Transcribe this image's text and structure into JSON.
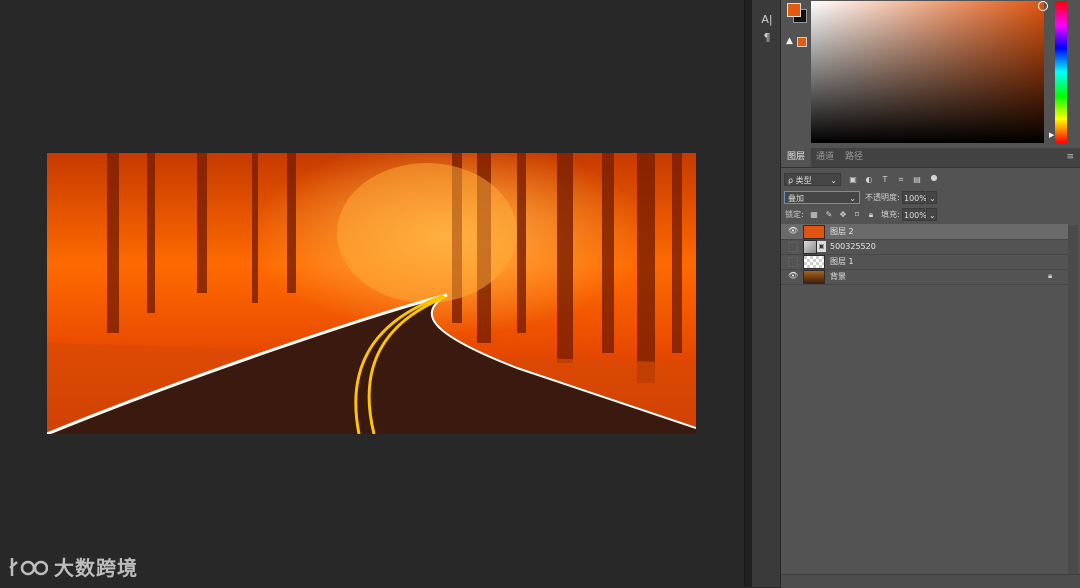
{
  "tool_strip": {
    "character_icon_glyph": "A|",
    "paragraph_icon_glyph": "¶"
  },
  "color_panel": {
    "foreground_color": "#e05a12",
    "background_color": "#111111",
    "warning_glyph": "▲"
  },
  "layers_panel": {
    "tabs": [
      {
        "label": "图层",
        "active": true
      },
      {
        "label": "通道",
        "active": false
      },
      {
        "label": "路径",
        "active": false
      }
    ],
    "menu_glyph": "≡",
    "filter_kind": "ρ 类型",
    "blend_mode": "叠加",
    "opacity_label": "不透明度:",
    "opacity_value": "100%",
    "lock_label": "锁定:",
    "fill_label": "填充:",
    "fill_value": "100%",
    "layers": [
      {
        "name": "图层 2",
        "visible": true,
        "selected": true,
        "thumb": "orange-fill",
        "locked": false
      },
      {
        "name": "500325520",
        "visible": false,
        "selected": false,
        "thumb": "smart-object",
        "locked": false
      },
      {
        "name": "图层 1",
        "visible": false,
        "selected": false,
        "thumb": "transparent",
        "locked": false
      },
      {
        "name": "背景",
        "visible": true,
        "selected": false,
        "thumb": "photo",
        "locked": true
      }
    ]
  },
  "watermark": {
    "text": "大数跨境"
  }
}
